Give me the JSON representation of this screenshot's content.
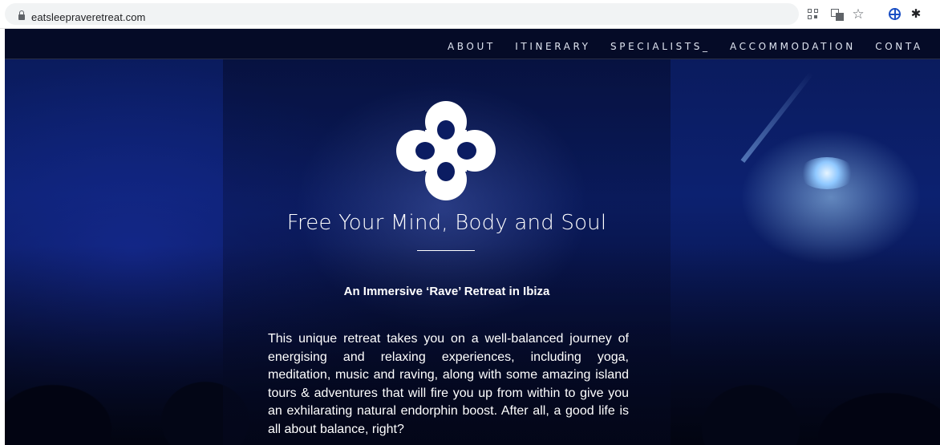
{
  "browser": {
    "url": "eatsleepraveretreat.com",
    "icons": [
      "lock-icon",
      "qr-code-icon",
      "translate-icon",
      "star-icon",
      "globe-extension-icon",
      "puzzle-icon"
    ],
    "star_glyph": "☆",
    "puzzle_glyph": "✱"
  },
  "nav": {
    "items": [
      {
        "label": "ABOUT"
      },
      {
        "label": "ITINERARY"
      },
      {
        "label": "SPECIALISTS_"
      },
      {
        "label": "ACCOMMODATION"
      },
      {
        "label": "CONTA"
      }
    ]
  },
  "hero": {
    "logo_color": "#ffffff",
    "headline": "Free Your Mind, Body and Soul",
    "subheading": "An Immersive ‘Rave’ Retreat in Ibiza",
    "body": "This unique retreat takes you on a well-balanced journey of energising and relaxing experiences, including yoga, meditation, music and raving, along with some amazing island tours & adventures that will fire you up from within to give you an exhilarating natural endorphin boost. After all, a good life is all about balance, right?"
  },
  "colors": {
    "background_blue": "#0c2170",
    "nav_bg": "#050a23",
    "text": "#ffffff",
    "extension_blue": "#1a4fc4"
  }
}
